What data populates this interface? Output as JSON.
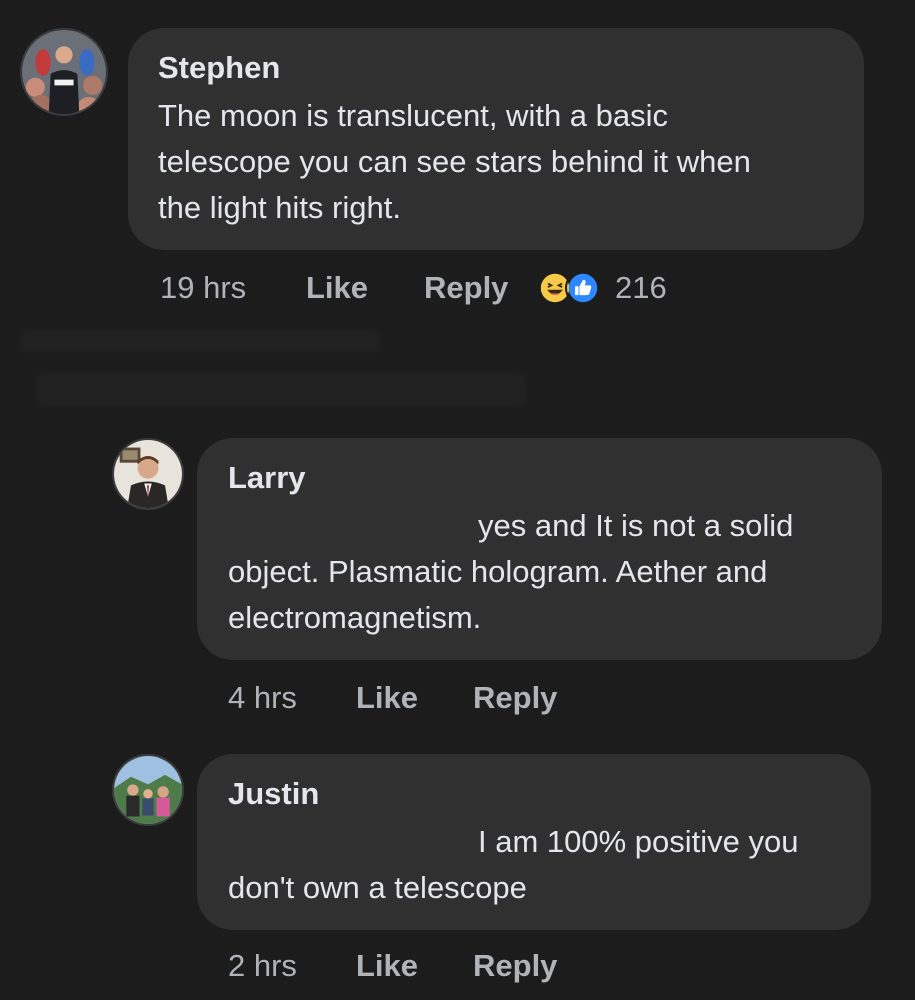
{
  "comments": [
    {
      "author": "Stephen",
      "text_lines": [
        "The moon is translucent, with a basic",
        "telescope you can see stars behind it when",
        "the light hits right."
      ],
      "time": "19 hrs",
      "like_label": "Like",
      "reply_label": "Reply",
      "reaction_icons": [
        "haha-icon",
        "like-icon"
      ],
      "reaction_count": "216"
    },
    {
      "author": "Larry",
      "text_lines": [
        "yes and It is not a solid",
        "object. Plasmatic hologram. Aether and",
        "electromagnetism."
      ],
      "time": "4 hrs",
      "like_label": "Like",
      "reply_label": "Reply"
    },
    {
      "author": "Justin",
      "text_lines": [
        "I am 100% positive you",
        "don't own a telescope"
      ],
      "time": "2 hrs",
      "like_label": "Like",
      "reply_label": "Reply"
    }
  ],
  "colors": {
    "background": "#1c1c1d",
    "bubble": "#303031",
    "primary_text": "#e4e6eb",
    "secondary_text": "#b0b3b8",
    "like_blue": "#2d88ff",
    "haha_yellow": "#f7c948"
  }
}
